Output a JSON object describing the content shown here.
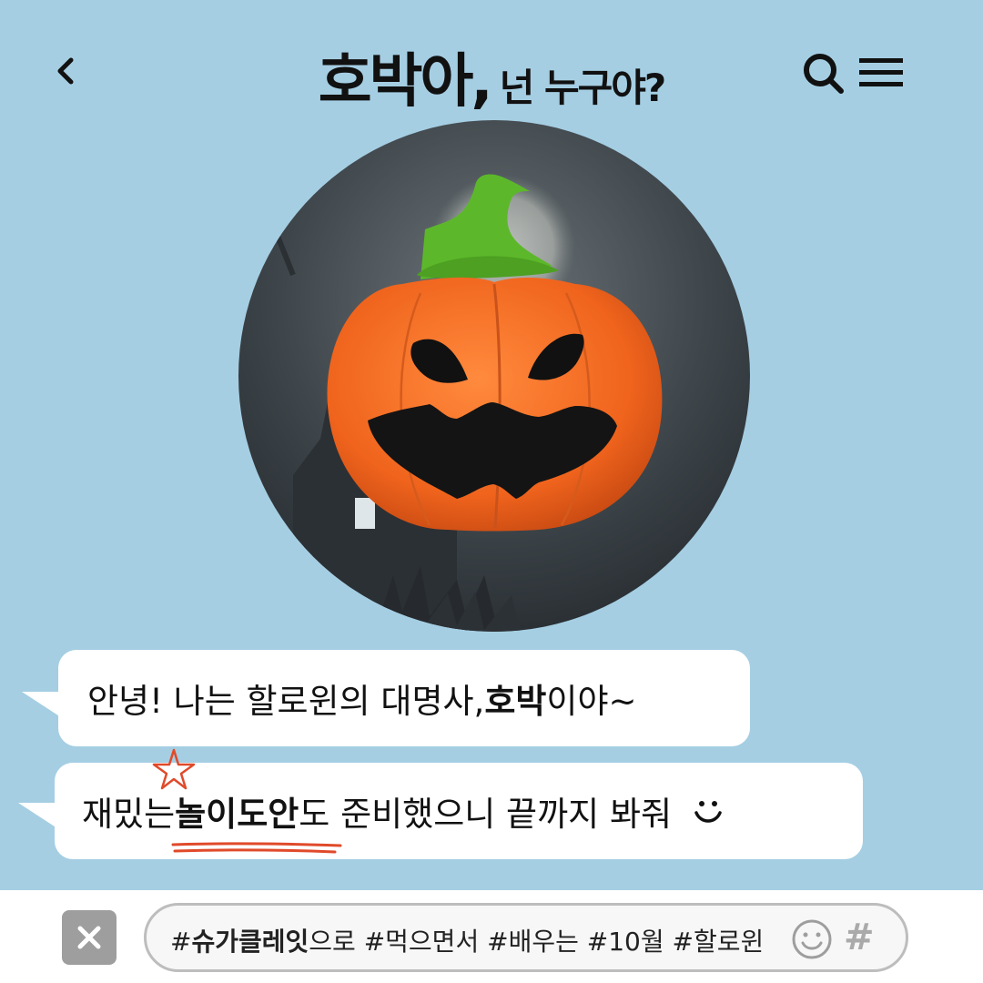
{
  "header": {
    "title_big": "호박아,",
    "title_small": "넌 누구야?"
  },
  "avatar": {
    "subject": "pumpkin-photo",
    "background": "#3a4045"
  },
  "messages": [
    {
      "pre": "안녕! 나는 할로윈의 대명사, ",
      "strong": "호박",
      "post": "이야~"
    },
    {
      "pre": "재밌는 ",
      "strong": "놀이도안",
      "post": "도 준비했으니 끝까지 봐줘"
    }
  ],
  "input": {
    "hash_prefix": "#",
    "hash_bold": "슈가클레잇",
    "rest": "으로 #먹으면서 #배우는 #10월 #할로윈",
    "hash_button": "#"
  },
  "colors": {
    "background": "#a5cee3",
    "bubble": "#ffffff",
    "accent_red": "#e04a2a",
    "pumpkin": "#f26a22",
    "stem": "#5cb82a"
  }
}
